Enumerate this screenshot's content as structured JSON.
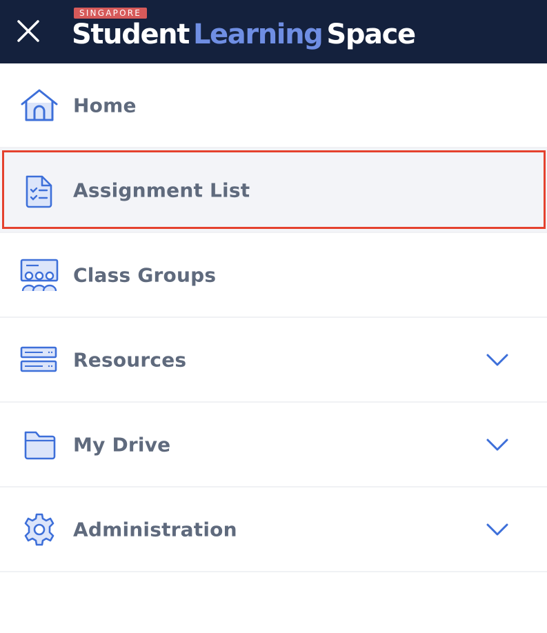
{
  "header": {
    "badge": "SINGAPORE",
    "brand_word1": "Student",
    "brand_word2": "Learning",
    "brand_word3": "Space"
  },
  "menu": {
    "items": [
      {
        "label": "Home",
        "icon": "home-icon"
      },
      {
        "label": "Assignment List",
        "icon": "assignment-icon",
        "selected": true
      },
      {
        "label": "Class Groups",
        "icon": "class-groups-icon"
      },
      {
        "label": "Resources",
        "icon": "resources-icon",
        "expandable": true
      },
      {
        "label": "My Drive",
        "icon": "folder-icon",
        "expandable": true
      },
      {
        "label": "Administration",
        "icon": "gear-icon",
        "expandable": true
      }
    ]
  },
  "colors": {
    "header_bg": "#14213d",
    "brand_accent": "#6f8ee3",
    "badge_bg": "#d65a5a",
    "icon_blue": "#3d6fd9",
    "label_gray": "#5f6a7d",
    "highlight_border": "#e4412e"
  }
}
